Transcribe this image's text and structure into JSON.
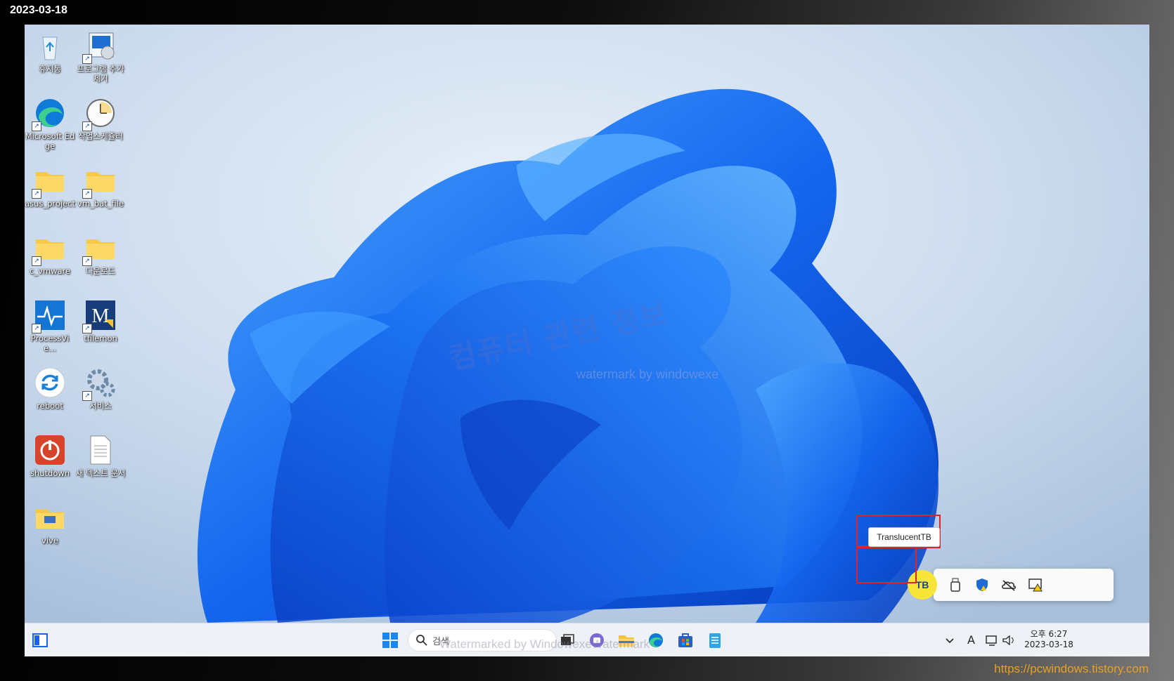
{
  "capture_date": "2023-03-18",
  "desktop_icons": [
    {
      "label": "휴지통",
      "icon": "recycle-bin-icon"
    },
    {
      "label": "프로그램 추가제거",
      "icon": "programs-icon"
    },
    {
      "label": "Microsoft Edge",
      "icon": "edge-icon"
    },
    {
      "label": "작업스케쥴러",
      "icon": "clock-icon"
    },
    {
      "label": "asus_project",
      "icon": "folder-icon"
    },
    {
      "label": "vm_bat_file",
      "icon": "folder-icon"
    },
    {
      "label": "c_vmware",
      "icon": "folder-icon"
    },
    {
      "label": "다운로드",
      "icon": "folder-icon"
    },
    {
      "label": "ProcessVie...",
      "icon": "process-monitor-icon"
    },
    {
      "label": "tfilemon",
      "icon": "filemon-icon"
    },
    {
      "label": "reboot",
      "icon": "reboot-icon"
    },
    {
      "label": "서비스",
      "icon": "gear-icon"
    },
    {
      "label": "shutdown",
      "icon": "power-icon"
    },
    {
      "label": "새 텍스트 문서",
      "icon": "text-document-icon"
    },
    {
      "label": "vive",
      "icon": "folder-icon"
    }
  ],
  "watermark": {
    "korean": "컴퓨터 관련 정보",
    "english": "watermark by windowexe",
    "taskbar_overlay": "Watermarked by WindowexeWatermark"
  },
  "taskbar": {
    "search_placeholder": "검색",
    "apps": [
      "start-icon",
      "search-icon",
      "task-view-icon",
      "chat-icon",
      "file-explorer-icon",
      "edge-icon",
      "store-icon",
      "notepad-icon"
    ],
    "ime_indicator": "A",
    "clock_ampm": "오후 6:27",
    "clock_date": "2023-03-18"
  },
  "tray_overflow": {
    "tooltip": "TranslucentTB",
    "icons": [
      "translucenttb-icon",
      "usb-icon",
      "defender-icon",
      "onedrive-icon",
      "warning-display-icon"
    ]
  },
  "footer_url": "https://pcwindows.tistory.com",
  "colors": {
    "accent": "#1a63e8",
    "highlight_box": "#e0222c",
    "footer_text": "#e8a020"
  }
}
